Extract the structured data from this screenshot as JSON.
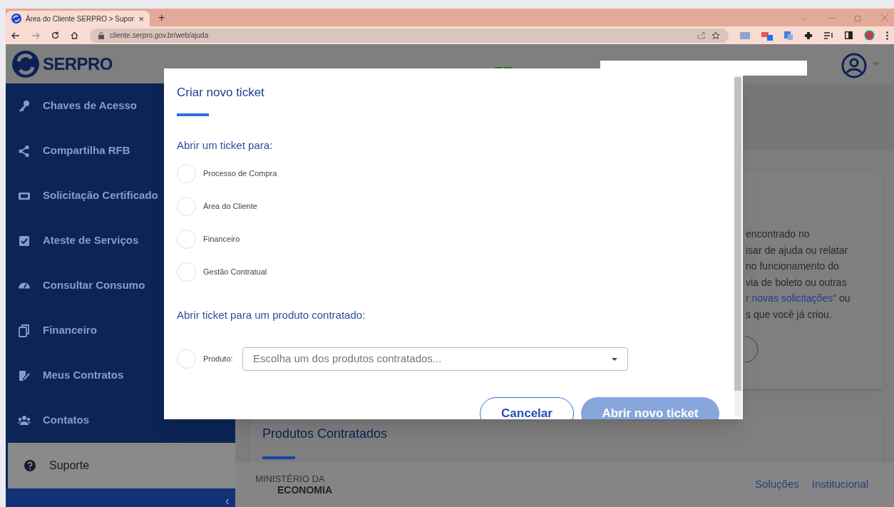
{
  "browser": {
    "tab_title": "Área do Cliente SERPRO > Supor",
    "tab_close": "×",
    "new_tab": "+",
    "url": "cliente.serpro.gov.br/web/ajuda"
  },
  "header": {
    "logo": "SERPRO"
  },
  "sidebar": {
    "items": [
      {
        "label": "Chaves de Acesso",
        "selected": false
      },
      {
        "label": "Compartilha RFB",
        "selected": false
      },
      {
        "label": "Solicitação Certificado",
        "selected": false
      },
      {
        "label": "Ateste de Serviços",
        "selected": false
      },
      {
        "label": "Consultar Consumo",
        "selected": false
      },
      {
        "label": "Financeiro",
        "selected": false
      },
      {
        "label": "Meus Contratos",
        "selected": false
      },
      {
        "label": "Contatos",
        "selected": false
      },
      {
        "label": "Suporte",
        "selected": true
      }
    ],
    "collapse": "‹"
  },
  "help_card": {
    "lines": [
      {
        "text": "encontrado no"
      },
      {
        "text": "isar de ajuda ou relatar"
      },
      {
        "text": "no funcionamento do"
      },
      {
        "text": "via de boleto ou outras"
      },
      {
        "link": "r novas solicitações\"",
        "text": " ou"
      },
      {
        "text": "s que você já criou."
      }
    ]
  },
  "products_card": {
    "title": "Produtos Contratados"
  },
  "footer": {
    "ministry": [
      "MINISTÉRIO DA",
      "ECONOMIA"
    ],
    "links": [
      "Soluções",
      "Institucional"
    ]
  },
  "modal": {
    "title": "Criar novo ticket",
    "section_1": "Abrir um ticket para:",
    "options": [
      {
        "label": "Processo de Compra",
        "selected": false
      },
      {
        "label": "Área do Cliente",
        "selected": false
      },
      {
        "label": "Financeiro",
        "selected": false
      },
      {
        "label": "Gestão Contratual",
        "selected": false
      }
    ],
    "section_2": "Abrir ticket para um produto contratado:",
    "product": {
      "label": "Produto:",
      "placeholder": "Escolha um dos produtos contratados...",
      "selected": false
    },
    "buttons": [
      {
        "label": "Cancelar",
        "kind": "secondary",
        "disabled": false
      },
      {
        "label": "Abrir novo ticket",
        "kind": "primary",
        "disabled": true
      }
    ]
  }
}
